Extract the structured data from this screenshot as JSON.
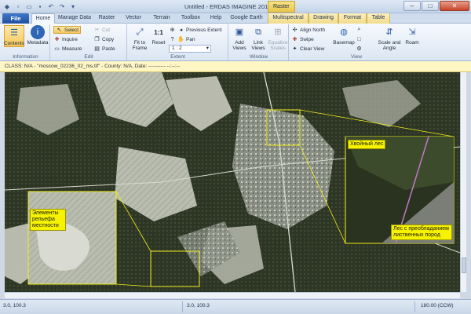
{
  "window": {
    "title": "Untitled - ERDAS IMAGINE 2011",
    "context_tab_group": "Raster"
  },
  "tabs": [
    "Home",
    "Manage Data",
    "Raster",
    "Vector",
    "Terrain",
    "Toolbox",
    "Help",
    "Google Earth",
    "Multispectral",
    "Drawing",
    "Format",
    "Table"
  ],
  "file_label": "File",
  "ribbon": {
    "information": {
      "label": "Information",
      "contents": "Contents",
      "metadata": "Metadata"
    },
    "edit": {
      "label": "Edit",
      "select": "Select",
      "inquire": "Inquire",
      "measure": "Measure",
      "cut": "Cut",
      "copy": "Copy",
      "paste": "Paste"
    },
    "extent": {
      "label": "Extent",
      "fit_to_frame": "Fit to Frame",
      "reset": "Reset",
      "previous_extent": "Previous Extent",
      "pan": "Pan",
      "scale_value": "1 : 2"
    },
    "window": {
      "label": "Window",
      "add_views": "Add Views",
      "link_views": "Link Views",
      "equalize_scales": "Equalize Scales"
    },
    "view": {
      "label": "View",
      "align_north": "Align North",
      "swipe": "Swipe",
      "clear_view": "Clear View",
      "basemap": "Basemap",
      "scale_and_angle": "Scale and Angle",
      "roam": "Roam"
    }
  },
  "info_bar": "CLASS: N/A - \"moscow_02236_02_ms.tif\" - County: N/A, Date: ---------- --:--:--",
  "annotations": {
    "relief": "Элементы рельефа местности",
    "conifer": "Хвойный лес",
    "deciduous": "Лес с преобладанием лиственных пород"
  },
  "status_bar": {
    "left": "3.0, 100.3",
    "middle": "3.0, 100.3",
    "right": "180.00 (CCW)"
  }
}
